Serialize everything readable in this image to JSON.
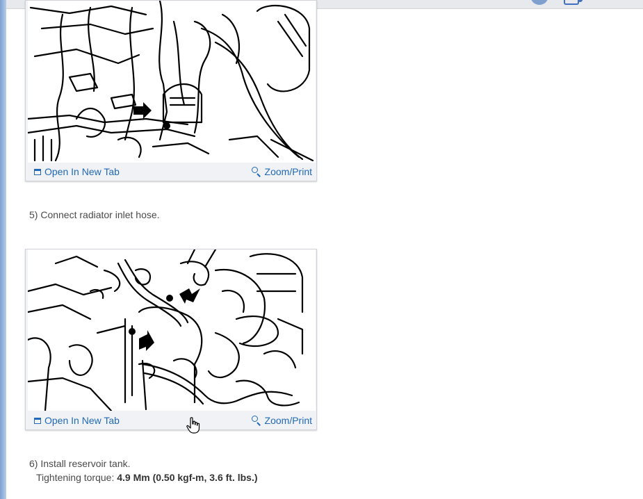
{
  "figures": [
    {
      "open_label": "Open In New Tab",
      "zoom_label": "Zoom/Print"
    },
    {
      "open_label": "Open In New Tab",
      "zoom_label": "Zoom/Print"
    }
  ],
  "steps": {
    "step5": "5) Connect radiator inlet hose.",
    "step6": "6) Install reservoir tank.",
    "torque_label": "Tightening torque:",
    "torque_value": "4.9 Mm (0.50 kgf-m, 3.6 ft. lbs.)"
  },
  "icons": {
    "open_tab": "open-in-new-tab-icon",
    "zoom": "zoom-magnifier-icon",
    "cursor": "hand-pointer-cursor"
  },
  "colors": {
    "link": "#1f69b8",
    "text": "#4a4a4a",
    "figure_bg": "#f1f2f5",
    "accent_strip": "#7a9fd0"
  }
}
